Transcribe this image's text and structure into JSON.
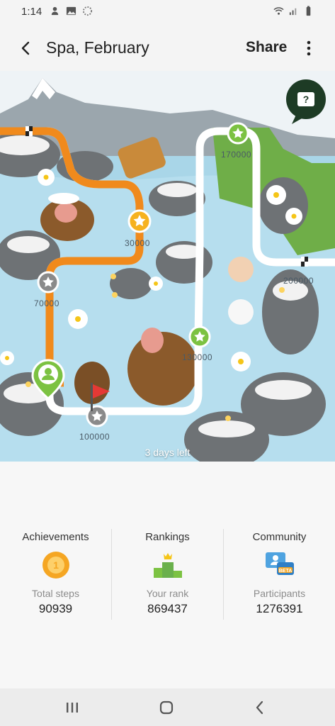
{
  "status_bar": {
    "time": "1:14",
    "left_icons": [
      "notification-icon",
      "image-icon",
      "sync-icon"
    ],
    "right_icons": [
      "wifi-icon",
      "signal-icon",
      "battery-icon"
    ]
  },
  "app_bar": {
    "title": "Spa, February",
    "share_label": "Share",
    "back_icon": "arrow-back-icon",
    "more_icon": "more-vert-icon"
  },
  "map": {
    "days_left": "3 days left",
    "help_icon": "question-chat-icon",
    "milestones": [
      "30000",
      "70000",
      "100000",
      "130000",
      "170000",
      "200000"
    ],
    "colors": {
      "progress": "#f08a1c",
      "track": "#ffffff",
      "water": "#a8d4e6",
      "milestone_reached": "#f6b21f",
      "milestone_gray": "#8a8a8a",
      "milestone_green": "#7cc242"
    }
  },
  "stats": {
    "achievements": {
      "title": "Achievements",
      "sublabel": "Total steps",
      "value": "90939",
      "icon": "medal-icon"
    },
    "rankings": {
      "title": "Rankings",
      "sublabel": "Your rank",
      "value": "869437",
      "icon": "podium-icon"
    },
    "community": {
      "title": "Community",
      "sublabel": "Participants",
      "value": "1276391",
      "icon": "community-beta-icon",
      "badge": "BETA"
    }
  },
  "nav_bar": {
    "recents_icon": "recents-icon",
    "home_icon": "home-icon",
    "back_icon": "nav-back-icon"
  }
}
